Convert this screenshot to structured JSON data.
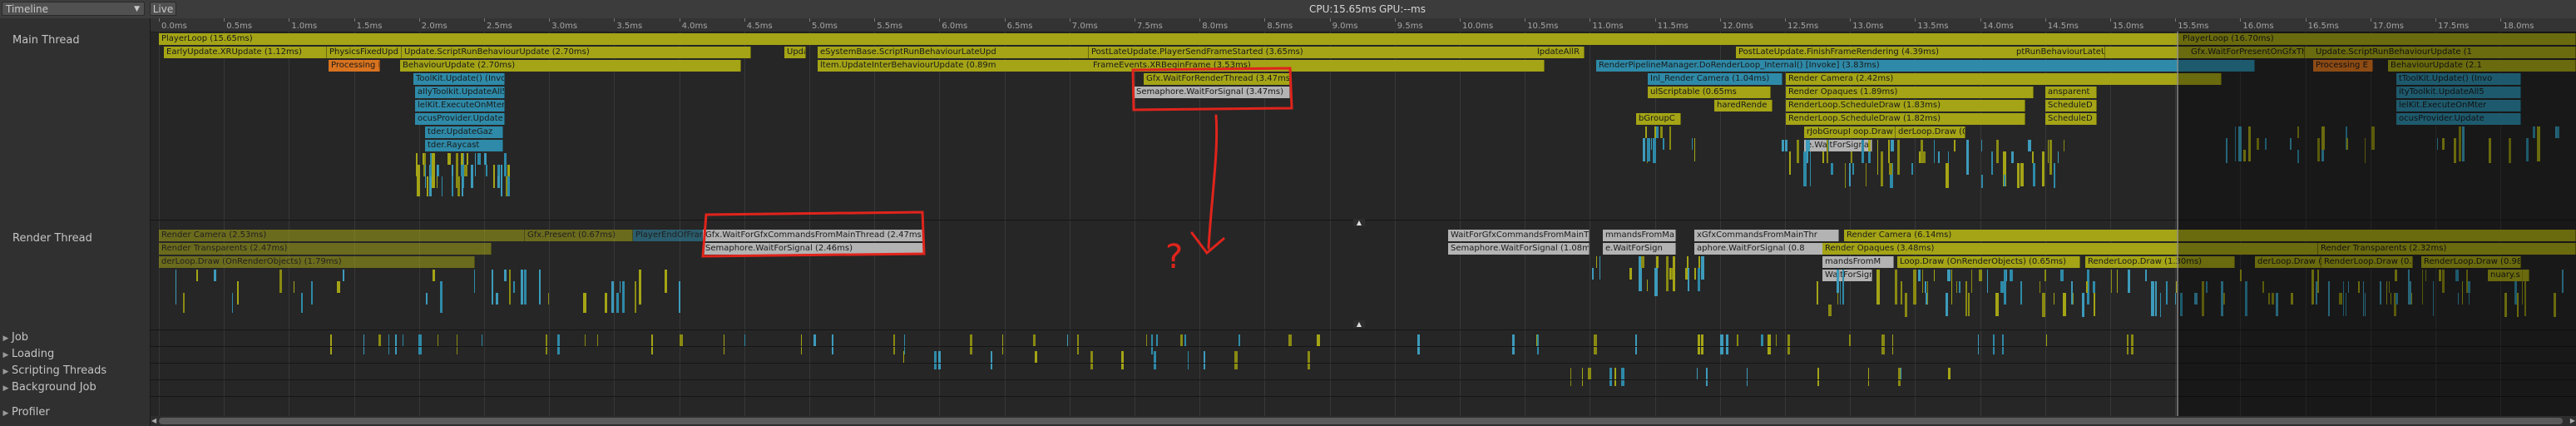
{
  "toolbar": {
    "view_dropdown": "Timeline",
    "live_button": "Live",
    "cpu_label": "CPU:15.65ms",
    "gpu_label": "GPU:--ms"
  },
  "threads": {
    "main_label": "Main Thread",
    "render_label": "Render Thread",
    "groups": [
      "Job",
      "Loading",
      "Scripting Threads",
      "Background Job",
      "Profiler"
    ]
  },
  "ruler_ticks": [
    "0.0ms",
    "0.5ms",
    "1.0ms",
    "1.5ms",
    "2.0ms",
    "2.5ms",
    "3.0ms",
    "3.5ms",
    "4.0ms",
    "4.5ms",
    "5.0ms",
    "5.5ms",
    "6.0ms",
    "6.5ms",
    "7.0ms",
    "7.5ms",
    "8.0ms",
    "8.5ms",
    "9.0ms",
    "9.5ms",
    "10.0ms",
    "10.5ms",
    "11.0ms",
    "11.5ms",
    "12.0ms",
    "12.5ms",
    "13.0ms",
    "13.5ms",
    "14.0ms",
    "14.5ms",
    "15.0ms",
    "15.5ms",
    "16.0ms",
    "16.5ms",
    "17.0ms",
    "17.5ms",
    "18.0ms"
  ],
  "main_bars": [
    {
      "label": "PlayerLoop (15.65ms)",
      "color": "#a4a416"
    },
    {
      "label": "EarlyUpdate.XRUpdate (1.12ms)",
      "color": "#a4a416"
    },
    {
      "label": "PhysicsFixedUpd",
      "color": "#a4a416"
    },
    {
      "label": "Update.ScriptRunBehaviourUpdate (2.70ms)",
      "color": "#a4a416"
    },
    {
      "label": "Update.K",
      "color": "#a4a416"
    },
    {
      "label": "eSystemBase.ScriptRunBehaviourLateUpd",
      "color": "#a4a416"
    },
    {
      "label": "PostLateUpdate.PlayerSendFrameStarted (3.65ms)",
      "color": "#a4a416"
    },
    {
      "label": "lpdateAllR",
      "color": "#a4a416"
    },
    {
      "label": "PostLateUpdate.FinishFrameRendering (4.39ms)",
      "color": "#a4a416"
    },
    {
      "label": "Processing E",
      "color": "#d9731f"
    },
    {
      "label": "BehaviourUpdate (2.70ms)",
      "color": "#a4a416"
    },
    {
      "label": "ltem.UpdateInterBehaviourUpdate (0.89m",
      "color": "#a4a416"
    },
    {
      "label": "FrameEvents.XRBeginFrame (3.53ms)",
      "color": "#a4a416"
    },
    {
      "label": "RenderPipelineManager.DoRenderLoop_Internal() [Invoke] (3.83ms)",
      "color": "#2e8aa8"
    },
    {
      "label": "ToolKit.Update() (Invo",
      "color": "#2e8aa8"
    },
    {
      "label": "Gfx.WaitForRenderThread (3.47ms)",
      "color": "#a4a416"
    },
    {
      "label": "Inl_Render Camera (1.04ms)",
      "color": "#2e8aa8"
    },
    {
      "label": "Render Camera (2.42ms)",
      "color": "#a4a416"
    },
    {
      "label": "aIlyToolkit.UpdateAll5",
      "color": "#2e8aa8"
    },
    {
      "label": "Semaphore.WaitForSignal (3.47ms)",
      "color": "#b3b3b3"
    },
    {
      "label": "ulScriptable (0.65ms",
      "color": "#a4a416"
    },
    {
      "label": "Render Opaques (1.89ms)",
      "color": "#a4a416"
    },
    {
      "label": "ansparent",
      "color": "#a4a416"
    },
    {
      "label": "lelKit.ExecuteOnMter",
      "color": "#2e8aa8"
    },
    {
      "label": "haredRende",
      "color": "#a4a416"
    },
    {
      "label": "RenderLoop.ScheduleDraw (1.83ms)",
      "color": "#a4a416"
    },
    {
      "label": "ScheduleD",
      "color": "#a4a416"
    },
    {
      "label": "ocusProvider.Update",
      "color": "#2e8aa8"
    },
    {
      "label": "bGroupC",
      "color": "#a4a416"
    },
    {
      "label": "RenderLoop.ScheduleDraw (1.82ms)",
      "color": "#a4a416"
    },
    {
      "label": "ScheduleD",
      "color": "#a4a416"
    },
    {
      "label": "tder.UpdateGaz",
      "color": "#2e8aa8"
    },
    {
      "label": "rJobGroupID (0.",
      "color": "#a4a416"
    },
    {
      "label": "oop.Draw (",
      "color": "#a4a416"
    },
    {
      "label": "derLoop.Draw (0.5",
      "color": "#a4a416"
    },
    {
      "label": "tder.Raycast",
      "color": "#2e8aa8"
    },
    {
      "label": "e.WaitForSigna",
      "color": "#b3b3b3"
    },
    {
      "label": "PlayerLoop (16.70ms)",
      "color": "#a4a416"
    },
    {
      "label": "Gfx.WaitForPresentOnGfxThread (x",
      "color": "#a4a416"
    },
    {
      "label": "Update.ScriptRunBehaviourUpdate (1",
      "color": "#a4a416"
    },
    {
      "label": "ptRunBehaviourLateUpd",
      "color": "#a4a416"
    },
    {
      "label": "Processing E",
      "color": "#d9731f"
    },
    {
      "label": "BehaviourUpdate (2.1",
      "color": "#a4a416"
    },
    {
      "label": "tToolKit.Update() (Invo",
      "color": "#2e8aa8"
    },
    {
      "label": "ityToolkit.UpdateAll5",
      "color": "#2e8aa8"
    },
    {
      "label": "lelKit.ExecuteOnMter",
      "color": "#2e8aa8"
    },
    {
      "label": "ocusProvider.Update",
      "color": "#2e8aa8"
    }
  ],
  "render_bars": [
    {
      "label": "Render Camera (2.53ms)",
      "color": "#a4a416"
    },
    {
      "label": "Gfx.Present (0.67ms)",
      "color": "#a4a416"
    },
    {
      "label": "PlayerEndOfFrame (1.06ms)",
      "color": "#2e8aa8"
    },
    {
      "label": "ForGfx",
      "color": "#a4a416"
    },
    {
      "label": "Gfx.WaitForGfxCommandsFromMainThread (2.47ms)",
      "color": "#b3b3b3"
    },
    {
      "label": "WaitForGfxCommandsFromMainThread",
      "color": "#b3b3b3"
    },
    {
      "label": "mmandsFromMa",
      "color": "#b3b3b3"
    },
    {
      "label": "xGfxCommandsFromMainThr",
      "color": "#b3b3b3"
    },
    {
      "label": "Render Camera (6.14ms)",
      "color": "#a4a416"
    },
    {
      "label": "Render Transparents (2.47ms)",
      "color": "#a4a416"
    },
    {
      "label": "Semaphore.WaitForSignal (2.46ms)",
      "color": "#b3b3b3"
    },
    {
      "label": "Semaphore.WaitForSignal (1.08ms)",
      "color": "#b3b3b3"
    },
    {
      "label": "e.WaitForSign",
      "color": "#b3b3b3"
    },
    {
      "label": "aphore.WaitForSignal (0.8",
      "color": "#b3b3b3"
    },
    {
      "label": "Render Opaques (3.48ms)",
      "color": "#a4a416"
    },
    {
      "label": "Render Transparents (2.32ms)",
      "color": "#a4a416"
    },
    {
      "label": "derLoop.Draw (OnRenderObjects) (1.79ms)",
      "color": "#a4a416"
    },
    {
      "label": "mandsFromM",
      "color": "#b3b3b3"
    },
    {
      "label": "Loop.Draw (OnRenderObjects) (0.65ms)",
      "color": "#a4a416"
    },
    {
      "label": "RenderLoop.Draw (1.30ms)",
      "color": "#a4a416"
    },
    {
      "label": "derLoop.Draw (0.6",
      "color": "#a4a416"
    },
    {
      "label": "RenderLoop.Draw (0.73m",
      "color": "#a4a416"
    },
    {
      "label": "RenderLoop.Draw (0.98ms)",
      "color": "#a4a416"
    },
    {
      "label": "WaitForSign",
      "color": "#b3b3b3"
    },
    {
      "label": "nuary.s",
      "color": "#a4a416"
    }
  ],
  "annotation": {
    "question_text": "?",
    "color": "#e0241c"
  },
  "colors": {
    "cpu_yellow": "#a4a416",
    "script_blue": "#2e8aa8",
    "wait_grey": "#b3b3b3",
    "gc_orange": "#d9731f"
  }
}
